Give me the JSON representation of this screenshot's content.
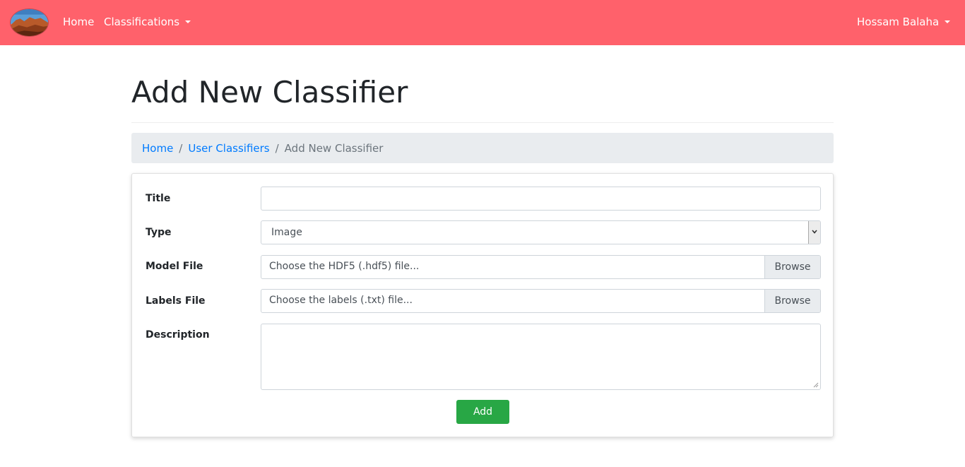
{
  "navbar": {
    "home_label": "Home",
    "classifications_label": "Classifications",
    "user_label": "Hossam Balaha",
    "background_color": "#ff616b"
  },
  "page": {
    "title": "Add New Classifier"
  },
  "breadcrumb": {
    "items": [
      "Home",
      "User Classifiers",
      "Add New Classifier"
    ]
  },
  "form": {
    "title_label": "Title",
    "title_value": "",
    "type_label": "Type",
    "type_selected": "Image",
    "model_file_label": "Model File",
    "model_file_placeholder": "Choose the HDF5 (.hdf5) file...",
    "labels_file_label": "Labels File",
    "labels_file_placeholder": "Choose the labels (.txt) file...",
    "browse_label": "Browse",
    "description_label": "Description",
    "description_value": "",
    "submit_label": "Add",
    "submit_color": "#28a745"
  },
  "icons": {
    "logo": "landscape-logo-icon",
    "dropdown_caret": "caret-down-icon",
    "select_arrow": "chevron-down-icon",
    "resize": "resize-grip-icon"
  }
}
